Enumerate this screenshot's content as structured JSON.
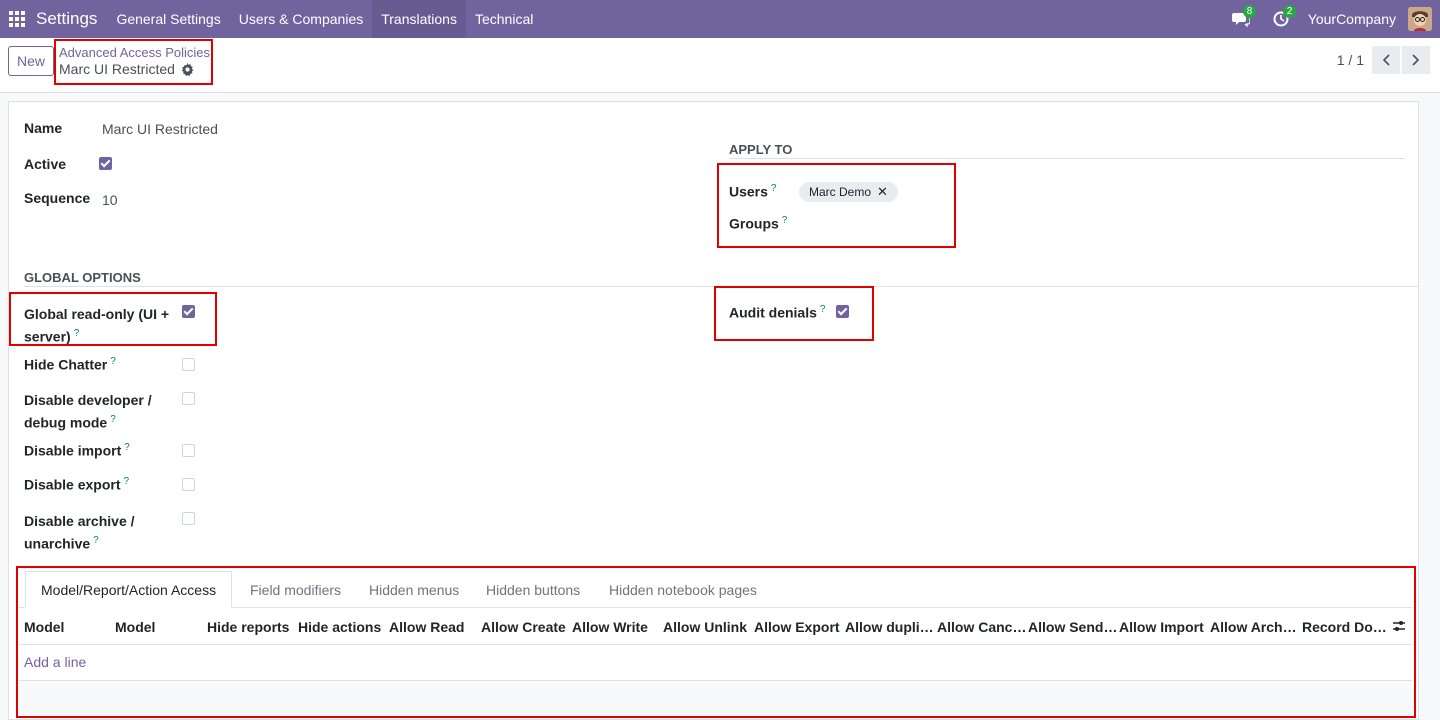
{
  "navbar": {
    "app_name": "Settings",
    "menus": [
      "General Settings",
      "Users & Companies",
      "Translations",
      "Technical"
    ],
    "active_menu": "Translations",
    "messages_badge": "8",
    "activities_badge": "2",
    "company": "YourCompany"
  },
  "control": {
    "new_label": "New",
    "breadcrumb_parent": "Advanced Access Policies",
    "breadcrumb_current": "Marc UI Restricted",
    "pager": "1 / 1"
  },
  "form": {
    "name_label": "Name",
    "name_value": "Marc UI Restricted",
    "active_label": "Active",
    "active_checked": true,
    "sequence_label": "Sequence",
    "sequence_value": "10",
    "apply_to_title": "APPLY TO",
    "users_label": "Users",
    "users_tag": "Marc Demo",
    "groups_label": "Groups",
    "global_options_title": "GLOBAL OPTIONS",
    "global_readonly_line1": "Global read-only (UI +",
    "global_readonly_line2": "server)",
    "global_readonly_checked": true,
    "audit_label": "Audit denials",
    "audit_checked": true,
    "hide_chatter_label": "Hide Chatter",
    "disable_dev_line1": "Disable developer /",
    "disable_dev_line2": "debug mode",
    "disable_import_label": "Disable import",
    "disable_export_label": "Disable export",
    "disable_archive_line1": "Disable archive /",
    "disable_archive_line2": "unarchive"
  },
  "notebook": {
    "tabs": [
      "Model/Report/Action Access",
      "Field modifiers",
      "Hidden menus",
      "Hidden buttons",
      "Hidden notebook pages"
    ],
    "columns": [
      "Model",
      "Model",
      "Hide reports",
      "Hide actions",
      "Allow Read",
      "Allow Create",
      "Allow Write",
      "Allow Unlink",
      "Allow Export",
      "Allow dupli…",
      "Allow Canc…",
      "Allow Send…",
      "Allow Import",
      "Allow Arch…",
      "Record Do…"
    ],
    "add_line": "Add a line"
  },
  "colors": {
    "brand": "#71639e",
    "highlight": "#e00000",
    "tooltip": "#017e84"
  }
}
